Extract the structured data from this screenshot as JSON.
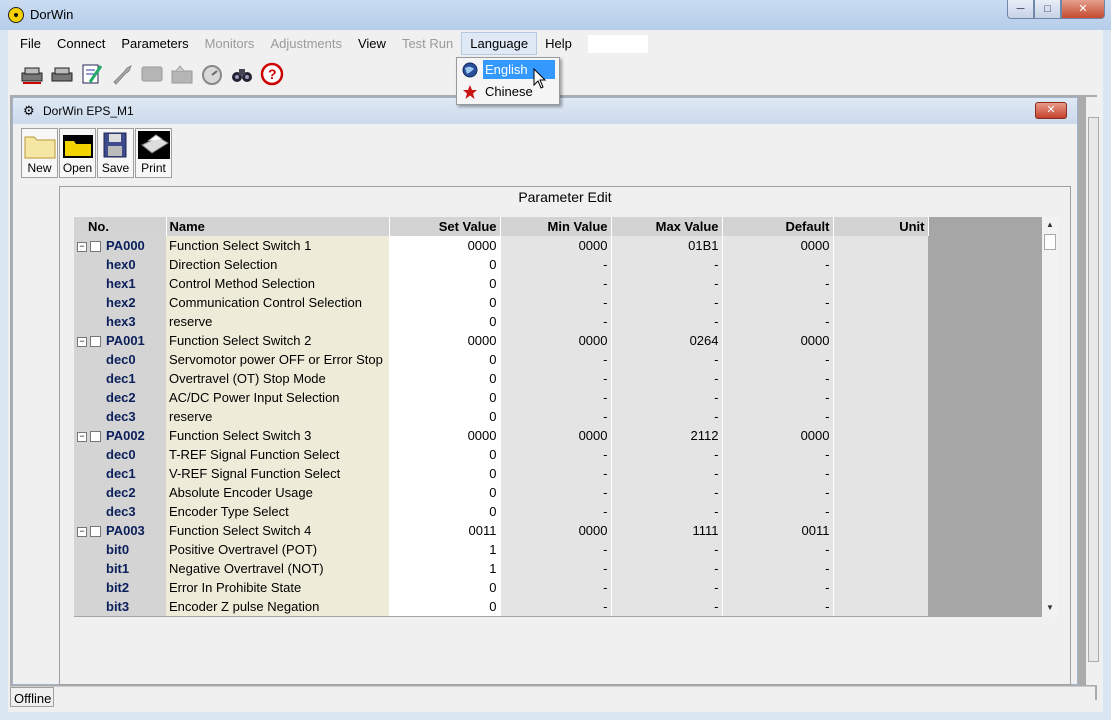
{
  "window": {
    "title": "DorWin"
  },
  "menubar": {
    "items": [
      {
        "label": "File",
        "disabled": false
      },
      {
        "label": "Connect",
        "disabled": false
      },
      {
        "label": "Parameters",
        "disabled": false
      },
      {
        "label": "Monitors",
        "disabled": true
      },
      {
        "label": "Adjustments",
        "disabled": true
      },
      {
        "label": "View",
        "disabled": false
      },
      {
        "label": "Test Run",
        "disabled": true
      },
      {
        "label": "Language",
        "disabled": false
      },
      {
        "label": "Help",
        "disabled": false
      }
    ]
  },
  "language_menu": {
    "items": [
      {
        "label": "English",
        "icon": "globe-icon"
      },
      {
        "label": "Chinese",
        "icon": "red-star-icon"
      }
    ]
  },
  "toolbar_icons": [
    "connect-icon",
    "disconnect-icon",
    "edit-params-icon",
    "wrench-icon",
    "monitor-icon",
    "tools-icon",
    "gauge-icon",
    "binoculars-icon",
    "help-icon"
  ],
  "child_window": {
    "title": "DorWin  EPS_M1",
    "buttons": {
      "new": "New",
      "open": "Open",
      "save": "Save",
      "print": "Print"
    },
    "panel_title": "Parameter Edit"
  },
  "table": {
    "columns": [
      "No.",
      "Name",
      "Set Value",
      "Min Value",
      "Max Value",
      "Default",
      "Unit"
    ],
    "rows": [
      {
        "no": "PA000",
        "group": true,
        "name": "Function Select Switch 1",
        "set": "0000",
        "min": "0000",
        "max": "01B1",
        "def": "0000",
        "unit": ""
      },
      {
        "no": "hex0",
        "group": false,
        "name": "Direction Selection",
        "set": "0",
        "min": "-",
        "max": "-",
        "def": "-",
        "unit": ""
      },
      {
        "no": "hex1",
        "group": false,
        "name": "Control Method Selection",
        "set": "0",
        "min": "-",
        "max": "-",
        "def": "-",
        "unit": ""
      },
      {
        "no": "hex2",
        "group": false,
        "name": "Communication Control Selection",
        "set": "0",
        "min": "-",
        "max": "-",
        "def": "-",
        "unit": ""
      },
      {
        "no": "hex3",
        "group": false,
        "name": "reserve",
        "set": "0",
        "min": "-",
        "max": "-",
        "def": "-",
        "unit": ""
      },
      {
        "no": "PA001",
        "group": true,
        "name": "Function Select Switch 2",
        "set": "0000",
        "min": "0000",
        "max": "0264",
        "def": "0000",
        "unit": ""
      },
      {
        "no": "dec0",
        "group": false,
        "name": "Servomotor power OFF or Error Stop",
        "set": "0",
        "min": "-",
        "max": "-",
        "def": "-",
        "unit": ""
      },
      {
        "no": "dec1",
        "group": false,
        "name": "Overtravel (OT) Stop Mode",
        "set": "0",
        "min": "-",
        "max": "-",
        "def": "-",
        "unit": ""
      },
      {
        "no": "dec2",
        "group": false,
        "name": "AC/DC Power Input Selection",
        "set": "0",
        "min": "-",
        "max": "-",
        "def": "-",
        "unit": ""
      },
      {
        "no": "dec3",
        "group": false,
        "name": "reserve",
        "set": "0",
        "min": "-",
        "max": "-",
        "def": "-",
        "unit": ""
      },
      {
        "no": "PA002",
        "group": true,
        "name": "Function Select Switch 3",
        "set": "0000",
        "min": "0000",
        "max": "2112",
        "def": "0000",
        "unit": ""
      },
      {
        "no": "dec0",
        "group": false,
        "name": "T-REF Signal Function Select",
        "set": "0",
        "min": "-",
        "max": "-",
        "def": "-",
        "unit": ""
      },
      {
        "no": "dec1",
        "group": false,
        "name": "V-REF Signal Function Select",
        "set": "0",
        "min": "-",
        "max": "-",
        "def": "-",
        "unit": ""
      },
      {
        "no": "dec2",
        "group": false,
        "name": "Absolute Encoder Usage",
        "set": "0",
        "min": "-",
        "max": "-",
        "def": "-",
        "unit": ""
      },
      {
        "no": "dec3",
        "group": false,
        "name": "Encoder Type Select",
        "set": "0",
        "min": "-",
        "max": "-",
        "def": "-",
        "unit": ""
      },
      {
        "no": "PA003",
        "group": true,
        "name": "Function Select Switch 4",
        "set": "0011",
        "min": "0000",
        "max": "1111",
        "def": "0011",
        "unit": ""
      },
      {
        "no": "bit0",
        "group": false,
        "name": "Positive Overtravel (POT)",
        "set": "1",
        "min": "-",
        "max": "-",
        "def": "-",
        "unit": ""
      },
      {
        "no": "bit1",
        "group": false,
        "name": "Negative Overtravel (NOT)",
        "set": "1",
        "min": "-",
        "max": "-",
        "def": "-",
        "unit": ""
      },
      {
        "no": "bit2",
        "group": false,
        "name": "Error In Prohibite State",
        "set": "0",
        "min": "-",
        "max": "-",
        "def": "-",
        "unit": ""
      },
      {
        "no": "bit3",
        "group": false,
        "name": "Encoder Z pulse Negation",
        "set": "0",
        "min": "-",
        "max": "-",
        "def": "-",
        "unit": ""
      }
    ]
  },
  "status": {
    "connection": "Offline"
  }
}
